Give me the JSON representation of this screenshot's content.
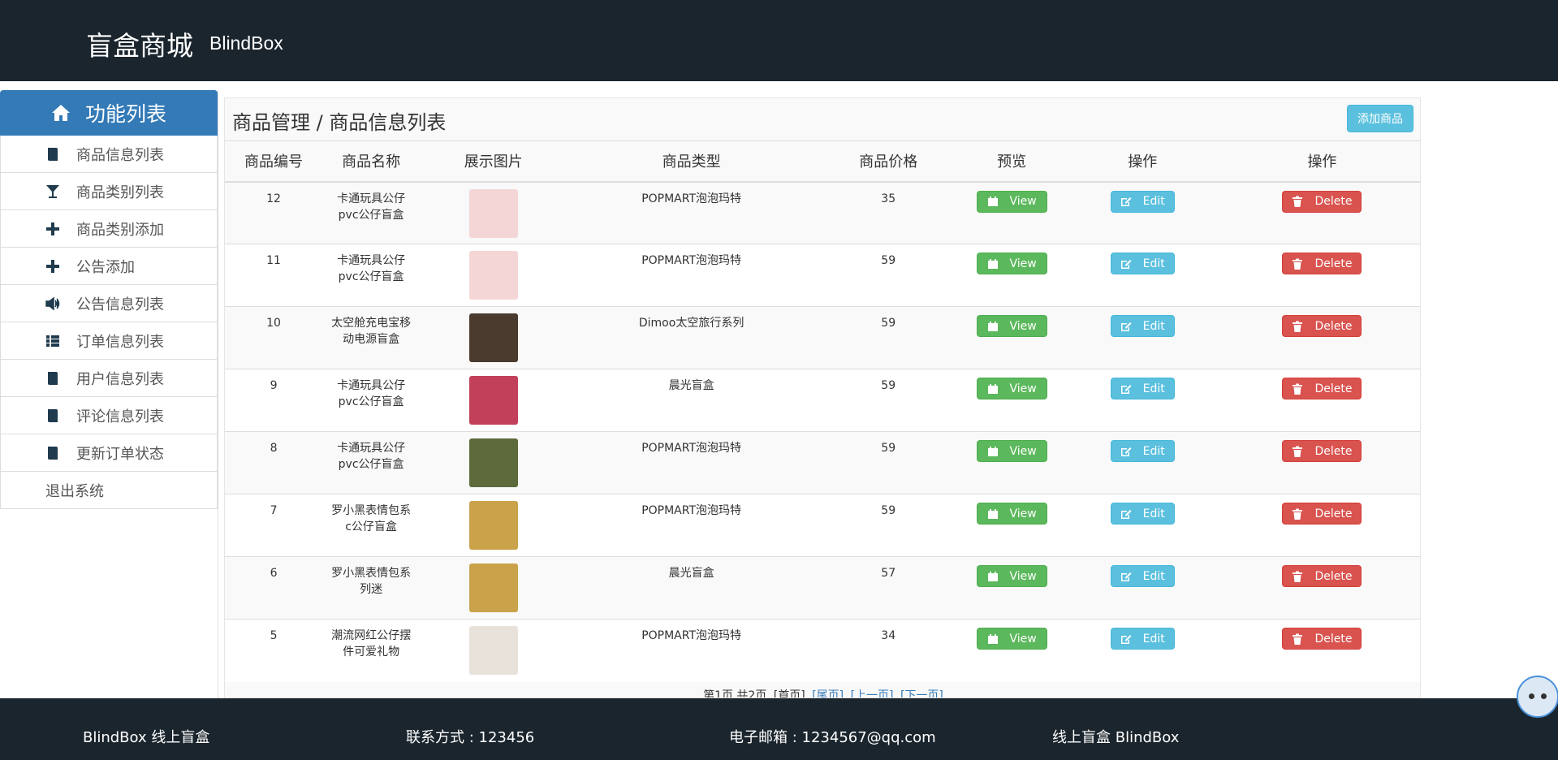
{
  "header": {
    "title_cn": "盲盒商城",
    "title_en": "BlindBox"
  },
  "sidebar": {
    "heading": "功能列表",
    "items": [
      {
        "label": "商品信息列表",
        "icon": "book-icon"
      },
      {
        "label": "商品类别列表",
        "icon": "glass-icon"
      },
      {
        "label": "商品类别添加",
        "icon": "plus-icon"
      },
      {
        "label": "公告添加",
        "icon": "plus-icon"
      },
      {
        "label": "公告信息列表",
        "icon": "volume-icon"
      },
      {
        "label": "订单信息列表",
        "icon": "list-icon"
      },
      {
        "label": "用户信息列表",
        "icon": "book-icon"
      },
      {
        "label": "评论信息列表",
        "icon": "book-icon"
      },
      {
        "label": "更新订单状态",
        "icon": "book-icon"
      }
    ],
    "logout": "退出系统"
  },
  "main": {
    "breadcrumb": "商品管理 / 商品信息列表",
    "add_button": "添加商品",
    "columns": [
      "商品编号",
      "商品名称",
      "展示图片",
      "商品类型",
      "商品价格",
      "预览",
      "操作",
      "操作"
    ],
    "view_label": "View",
    "edit_label": "Edit",
    "delete_label": "Delete",
    "rows": [
      {
        "id": "12",
        "name": "卡通玩具公仔\npvc公仔盲盒",
        "type": "POPMART泡泡玛特",
        "price": "35",
        "thumb": "#f4d6d6"
      },
      {
        "id": "11",
        "name": "卡通玩具公仔\npvc公仔盲盒",
        "type": "POPMART泡泡玛特",
        "price": "59",
        "thumb": "#f4d6d6"
      },
      {
        "id": "10",
        "name": "太空舱充电宝移\n动电源盲盒",
        "type": "Dimoo太空旅行系列",
        "price": "59",
        "thumb": "#4a3b2e"
      },
      {
        "id": "9",
        "name": "卡通玩具公仔\npvc公仔盲盒",
        "type": "晨光盲盒",
        "price": "59",
        "thumb": "#c2405a"
      },
      {
        "id": "8",
        "name": "卡通玩具公仔\npvc公仔盲盒",
        "type": "POPMART泡泡玛特",
        "price": "59",
        "thumb": "#5d6a3c"
      },
      {
        "id": "7",
        "name": "罗小黑表情包系\nc公仔盲盒",
        "type": "POPMART泡泡玛特",
        "price": "59",
        "thumb": "#c9a24a"
      },
      {
        "id": "6",
        "name": "罗小黑表情包系\n列迷",
        "type": "晨光盲盒",
        "price": "57",
        "thumb": "#c9a24a"
      },
      {
        "id": "5",
        "name": "潮流网红公仔摆\n件可爱礼物",
        "type": "POPMART泡泡玛特",
        "price": "34",
        "thumb": "#e8e2da"
      }
    ],
    "pager": {
      "text": "第1页   共2页",
      "first": "[首页]",
      "first_link": "[尾页]",
      "prev": "[上一页]",
      "next": "[下一页]"
    }
  },
  "footer": {
    "left": "BlindBox 线上盲盒",
    "contact": "联系方式 : 123456",
    "email": "电子邮箱 : 1234567@qq.com",
    "right": "线上盲盒 BlindBox"
  },
  "colors": {
    "nav_bg": "#1b252d",
    "primary": "#337ab7",
    "success": "#5cb85c",
    "info": "#5bc0de",
    "danger": "#d9534f"
  }
}
